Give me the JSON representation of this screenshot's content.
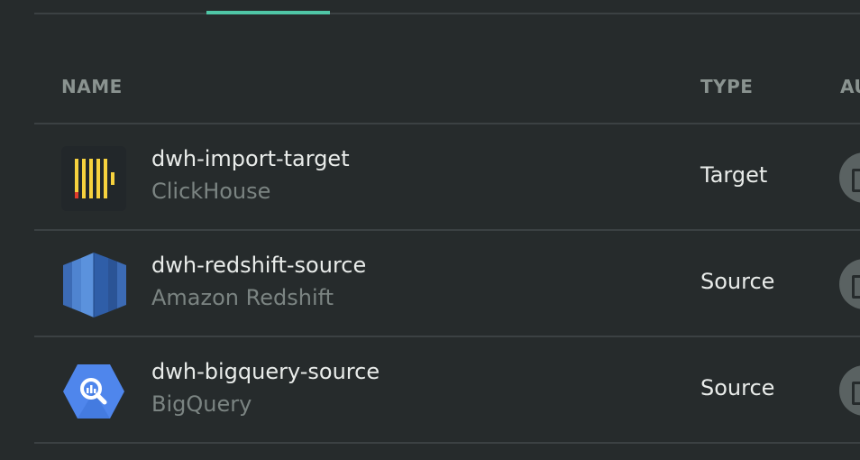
{
  "table": {
    "headers": {
      "name": "NAME",
      "type": "TYPE",
      "auth": "AU"
    },
    "rows": [
      {
        "name": "dwh-import-target",
        "subtitle": "ClickHouse",
        "type": "Target",
        "logo": "clickhouse-logo-icon"
      },
      {
        "name": "dwh-redshift-source",
        "subtitle": "Amazon Redshift",
        "type": "Source",
        "logo": "amazon-redshift-logo-icon"
      },
      {
        "name": "dwh-bigquery-source",
        "subtitle": "BigQuery",
        "type": "Source",
        "logo": "bigquery-logo-icon"
      }
    ]
  },
  "colors": {
    "background": "#262b2c",
    "accent": "#4fc6a6",
    "clickhouse_yellow": "#f7d23e",
    "clickhouse_red": "#e03b2d",
    "redshift_blue": "#3f6fba",
    "bigquery_blue": "#4f86ec"
  }
}
